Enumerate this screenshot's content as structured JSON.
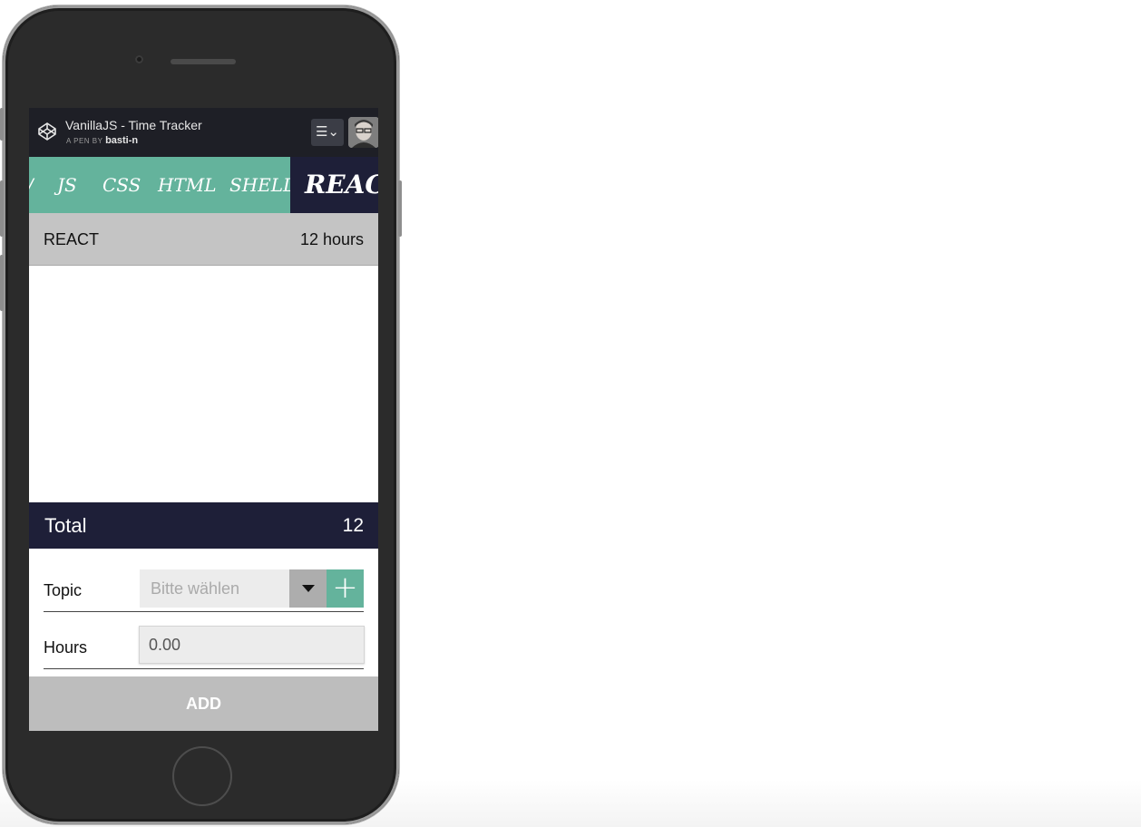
{
  "pen": {
    "title": "VanillaJS - Time Tracker",
    "by_prefix": "A PEN BY",
    "author": "basti-n",
    "menu_icon": "menu-toggle-icon",
    "menu_label": "☰⌄"
  },
  "tabs": [
    {
      "label": "/"
    },
    {
      "label": "JS"
    },
    {
      "label": "CSS"
    },
    {
      "label": "HTML"
    },
    {
      "label": "SHELL"
    },
    {
      "label": "REACT",
      "active": true
    }
  ],
  "selected_topic": {
    "name": "REACT",
    "hours": "12 hours"
  },
  "total": {
    "label": "Total",
    "value": "12"
  },
  "form": {
    "topic_label": "Topic",
    "topic_placeholder": "Bitte wählen",
    "add_topic_label": "+",
    "hours_label": "Hours",
    "hours_value": "0.00",
    "submit_label": "ADD"
  },
  "colors": {
    "accent": "#64b39c",
    "navy": "#1e1f38",
    "header": "#1e1f26",
    "row_grey": "#c4c4c4",
    "button_grey": "#bdbdbd"
  }
}
